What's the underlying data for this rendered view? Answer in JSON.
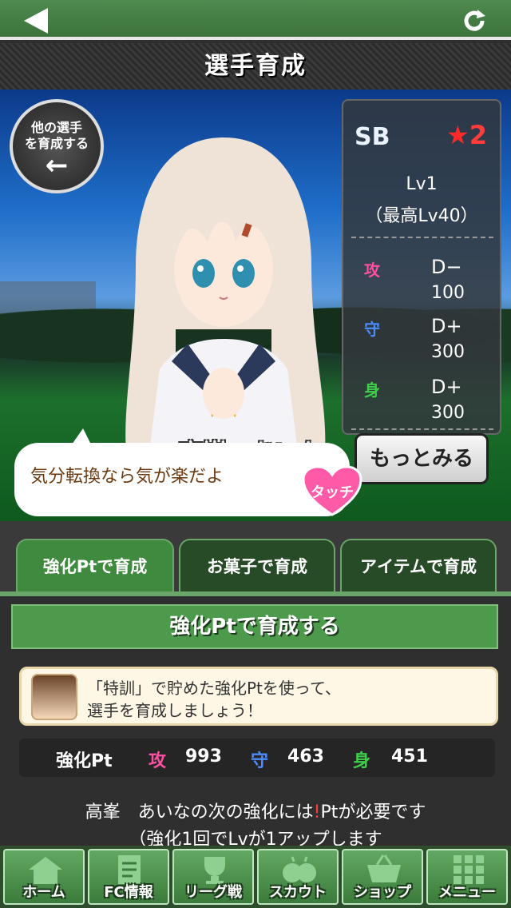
{
  "header": {
    "title": "選手育成"
  },
  "other_button": {
    "line1": "他の選手",
    "line2": "を育成する",
    "arrow": "←"
  },
  "player": {
    "position": "SB",
    "rarity": "2",
    "level": "Lv1",
    "max_level": "（最高Lv40）",
    "name": "高峯　あいな",
    "speech": "気分転換なら気が楽だよ",
    "touch_label": "タッチ"
  },
  "stats": [
    {
      "label": "攻",
      "grade": "D−",
      "value": "100",
      "color": "#ff4fa0"
    },
    {
      "label": "守",
      "grade": "D+",
      "value": "300",
      "color": "#4a8cff"
    },
    {
      "label": "身",
      "grade": "D+",
      "value": "300",
      "color": "#3ecf4a"
    }
  ],
  "more_button": "もっとみる",
  "tabs": [
    "強化Ptで育成",
    "お菓子で育成",
    "アイテムで育成"
  ],
  "section": {
    "header": "強化Ptで育成する",
    "info_line1": "「特訓」で貯めた強化Ptを使って、",
    "info_line2": "選手を育成しましょう！"
  },
  "points": {
    "label": "強化Pt",
    "atk_label": "攻",
    "atk": "993",
    "def_label": "守",
    "def": "463",
    "phy_label": "身",
    "phy": "451"
  },
  "requirement": {
    "part1": "高峯　あいなの次の強化には",
    "excl": "!",
    "part2": "Ptが必要です",
    "line2": "（強化1回でLvが1アップします"
  },
  "nav": [
    "ホーム",
    "FC情報",
    "リーグ戦",
    "スカウト",
    "ショップ",
    "メニュー"
  ],
  "colors": {
    "green": "#4d9a4d",
    "red": "#ff3b3b",
    "pink": "#ff4fa0",
    "blue": "#4a8cff",
    "lime": "#3ecf4a"
  }
}
